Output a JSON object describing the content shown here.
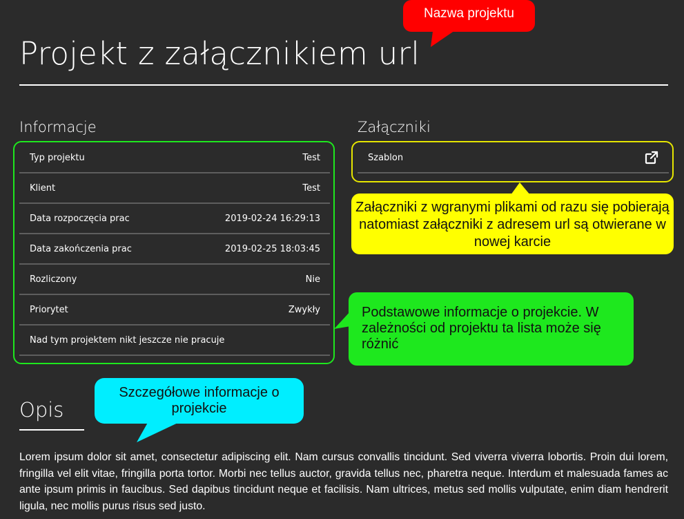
{
  "project": {
    "title": "Projekt z załącznikiem url"
  },
  "info": {
    "heading": "Informacje",
    "rows": [
      {
        "label": "Typ projektu",
        "value": "Test"
      },
      {
        "label": "Klient",
        "value": "Test"
      },
      {
        "label": "Data rozpoczęcia prac",
        "value": "2019-02-24 16:29:13"
      },
      {
        "label": "Data zakończenia prac",
        "value": "2019-02-25 18:03:45"
      },
      {
        "label": "Rozliczony",
        "value": "Nie"
      },
      {
        "label": "Priorytet",
        "value": "Zwykły"
      },
      {
        "label": "Nad tym projektem nikt jeszcze nie pracuje",
        "value": ""
      }
    ]
  },
  "attachments": {
    "heading": "Załączniki",
    "items": [
      {
        "name": "Szablon",
        "icon": "external-link-icon"
      }
    ]
  },
  "description": {
    "heading": "Opis",
    "text": "Lorem ipsum dolor sit amet, consectetur adipiscing elit. Nam cursus convallis tincidunt. Sed viverra viverra lobortis. Proin dui lorem, fringilla vel elit vitae, fringilla porta tortor. Morbi nec tellus auctor, gravida tellus nec, pharetra neque. Interdum et malesuada fames ac ante ipsum primis in faucibus. Sed dapibus tincidunt neque et facilisis. Nam ultrices, metus sed mollis vulputate, enim diam hendrerit ligula, nec mollis purus risus sed justo."
  },
  "callouts": {
    "project_name": "Nazwa projektu",
    "attachments_note": "Załączniki z wgranymi plikami od razu się pobierają natomiast załączniki z adresem url są otwierane w nowej karcie",
    "info_note": "Podstawowe informacje o projekcie. W zależności od projektu ta lista może się różnić",
    "description_note": "Szczegółowe informacje o projekcie"
  },
  "colors": {
    "background": "#2b2b2b",
    "callout_red": "#ff0000",
    "callout_yellow": "#ffff00",
    "callout_green": "#1ee81e",
    "callout_cyan": "#00eeff"
  }
}
